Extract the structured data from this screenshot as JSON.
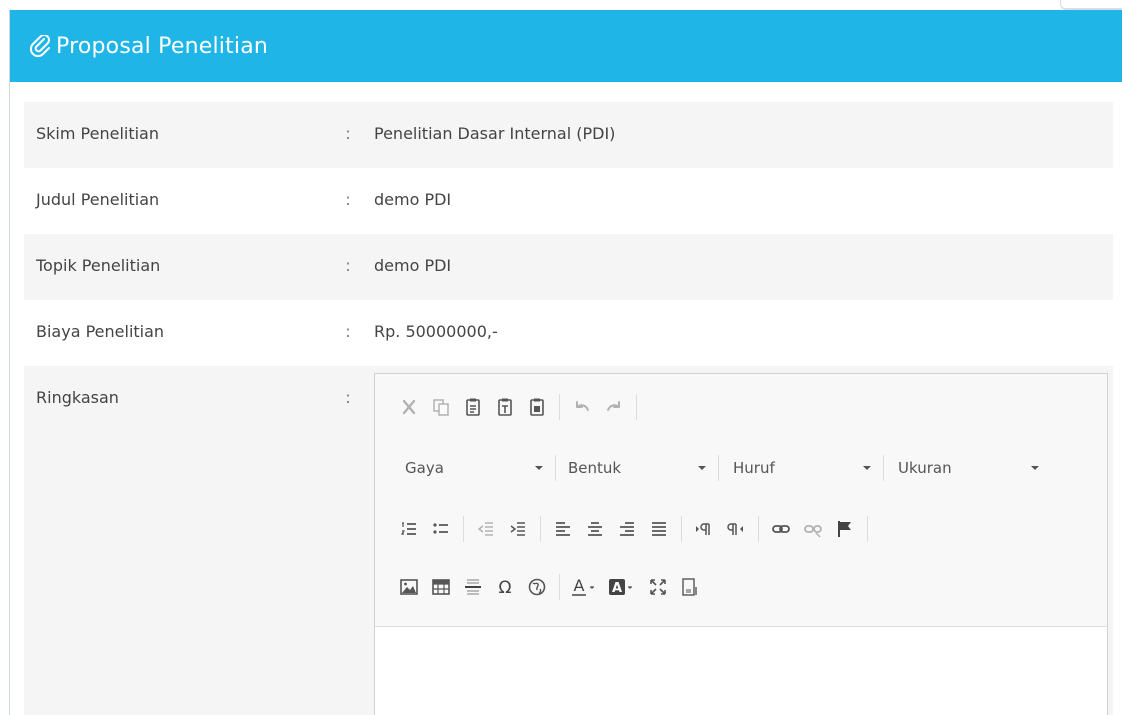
{
  "panel": {
    "title": "Proposal Penelitian",
    "header_color": "#1fb5e6"
  },
  "fields": [
    {
      "label": "Skim Penelitian",
      "colon": ":",
      "value": "Penelitian Dasar Internal (PDI)"
    },
    {
      "label": "Judul Penelitian",
      "colon": ":",
      "value": "demo PDI"
    },
    {
      "label": "Topik Penelitian",
      "colon": ":",
      "value": "demo PDI"
    },
    {
      "label": "Biaya Penelitian",
      "colon": ":",
      "value": "Rp. 50000000,-"
    },
    {
      "label": "Ringkasan",
      "colon": ":"
    }
  ],
  "editor": {
    "combos": [
      {
        "label": "Gaya"
      },
      {
        "label": "Bentuk"
      },
      {
        "label": "Huruf"
      },
      {
        "label": "Ukuran"
      }
    ]
  }
}
